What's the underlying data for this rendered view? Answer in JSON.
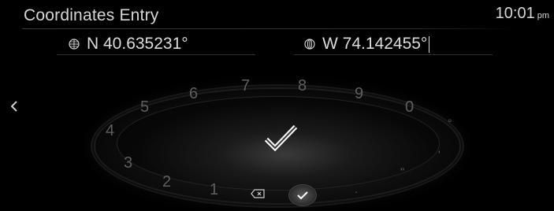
{
  "header": {
    "title": "Coordinates Entry",
    "time": "10:01",
    "ampm": "pm"
  },
  "coordinates": {
    "latitude": "N 40.635231°",
    "longitude": "W 74.142455°"
  },
  "dial": {
    "digits": [
      "1",
      "2",
      "3",
      "4",
      "5",
      "6",
      "7",
      "8",
      "9",
      "0"
    ],
    "symbols": [
      "°",
      "'",
      "''",
      "."
    ]
  },
  "icons": {
    "back": "chevron-left-icon",
    "globe": "globe-icon",
    "confirm": "checkmark-icon",
    "delete": "backspace-icon"
  }
}
